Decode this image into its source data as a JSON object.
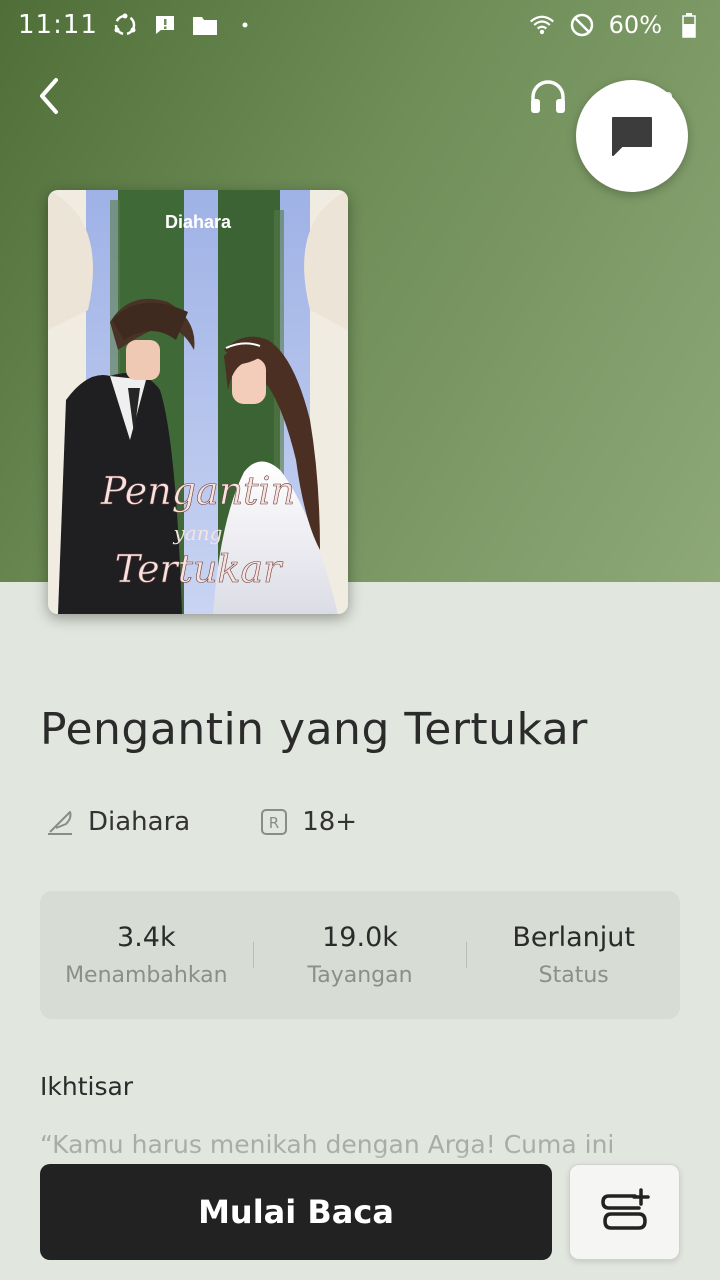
{
  "status_bar": {
    "time": "11:11",
    "battery": "60%",
    "icons": [
      "sync-icon",
      "alert-icon",
      "folder-icon",
      "wifi-icon",
      "do-not-disturb-icon",
      "battery-icon"
    ]
  },
  "header": {
    "back_icon": "chevron-left-icon",
    "audio_icon": "headphones-icon",
    "chat_icon": "chat-bubble-icon"
  },
  "cover": {
    "author_text": "Diahara",
    "title_line1": "Pengantin",
    "title_line2": "yang",
    "title_line3": "Tertukar"
  },
  "book": {
    "title": "Pengantin yang Tertukar",
    "author": "Diahara",
    "rating": "18+",
    "author_icon": "quill-icon",
    "rating_icon": "r-badge-icon"
  },
  "stats": [
    {
      "value": "3.4k",
      "label": "Menambahkan"
    },
    {
      "value": "19.0k",
      "label": "Tayangan"
    },
    {
      "value": "Berlanjut",
      "label": "Status"
    }
  ],
  "summary": {
    "title": "Ikhtisar",
    "preview": "“Kamu harus menikah dengan Arga! Cuma ini"
  },
  "actions": {
    "start_label": "Mulai Baca",
    "library_icon": "add-to-library-icon"
  },
  "colors": {
    "hero_start": "#4f6e38",
    "hero_end": "#8ea878",
    "background": "#e1e6de",
    "stats_bg": "#d7dcd4",
    "primary_button": "#222222"
  }
}
